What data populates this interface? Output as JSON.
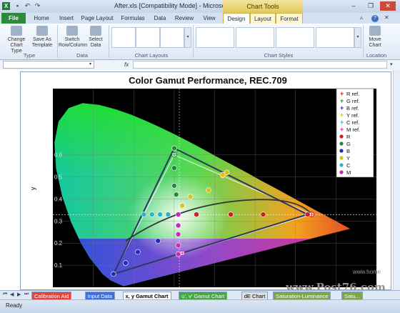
{
  "window": {
    "title": "After.xls  [Compatibility Mode] - Microsoft E...",
    "chart_tools_label": "Chart Tools",
    "quick_access": [
      "save-icon",
      "undo-icon",
      "redo-icon"
    ],
    "controls": [
      "minimize-icon",
      "restore-icon",
      "close-icon"
    ]
  },
  "tabs": [
    "File",
    "Home",
    "Insert",
    "Page Layout",
    "Formulas",
    "Data",
    "Review",
    "View",
    "Design",
    "Layout",
    "Format"
  ],
  "ribbon": {
    "groups": [
      {
        "label": "Type",
        "buttons": [
          "Change Chart Type",
          "Save As Template"
        ]
      },
      {
        "label": "Data",
        "buttons": [
          "Switch Row/Column",
          "Select Data"
        ]
      },
      {
        "label": "Chart Layouts"
      },
      {
        "label": "Chart Styles"
      },
      {
        "label": "Location",
        "buttons": [
          "Move Chart"
        ]
      }
    ]
  },
  "formula_bar": {
    "fx": "fx",
    "name_box": ""
  },
  "chart_data": {
    "type": "scatter",
    "title": "Color Gamut Performance, REC.709",
    "ylabel": "y",
    "y_ticks": [
      "0.1",
      "0.2",
      "0.3",
      "0.4",
      "0.5",
      "0.6"
    ],
    "xlim": [
      0.0,
      0.8
    ],
    "ylim": [
      0.0,
      0.9
    ],
    "legend": [
      "R ref.",
      "G ref.",
      "B ref.",
      "Y ref.",
      "C ref.",
      "M ref.",
      "R",
      "G",
      "B",
      "Y",
      "C",
      "M"
    ],
    "legend_colors": [
      "#cc2020",
      "#1f8a3a",
      "#1f2fb0",
      "#d8c21a",
      "#2ab5c0",
      "#c62bb8",
      "#cc2020",
      "#1f8a3a",
      "#1f2fb0",
      "#d8c21a",
      "#2ab5c0",
      "#c62bb8"
    ],
    "legend_placement": "top-right",
    "series": [
      {
        "name": "R ref.",
        "color": "#cc2020",
        "points": [
          [
            0.64,
            0.33
          ]
        ]
      },
      {
        "name": "G ref.",
        "color": "#1f8a3a",
        "points": [
          [
            0.3,
            0.6
          ]
        ]
      },
      {
        "name": "B ref.",
        "color": "#1f2fb0",
        "points": [
          [
            0.15,
            0.06
          ]
        ]
      },
      {
        "name": "Y ref.",
        "color": "#d8c21a",
        "points": [
          [
            0.42,
            0.505
          ]
        ]
      },
      {
        "name": "C ref.",
        "color": "#2ab5c0",
        "points": [
          [
            0.225,
            0.33
          ]
        ]
      },
      {
        "name": "M ref.",
        "color": "#c62bb8",
        "points": [
          [
            0.32,
            0.155
          ]
        ]
      },
      {
        "name": "R",
        "color": "#cc2020",
        "points": [
          [
            0.355,
            0.33
          ],
          [
            0.44,
            0.33
          ],
          [
            0.52,
            0.33
          ],
          [
            0.63,
            0.33
          ]
        ]
      },
      {
        "name": "G",
        "color": "#1f8a3a",
        "points": [
          [
            0.3,
            0.63
          ],
          [
            0.3,
            0.54
          ],
          [
            0.3,
            0.46
          ],
          [
            0.305,
            0.42
          ]
        ]
      },
      {
        "name": "B",
        "color": "#1f2fb0",
        "points": [
          [
            0.18,
            0.11
          ],
          [
            0.21,
            0.16
          ],
          [
            0.26,
            0.21
          ],
          [
            0.15,
            0.06
          ]
        ]
      },
      {
        "name": "Y",
        "color": "#d8c21a",
        "points": [
          [
            0.32,
            0.37
          ],
          [
            0.34,
            0.41
          ],
          [
            0.385,
            0.44
          ],
          [
            0.42,
            0.51
          ],
          [
            0.43,
            0.52
          ]
        ]
      },
      {
        "name": "C",
        "color": "#2ab5c0",
        "points": [
          [
            0.245,
            0.33
          ],
          [
            0.265,
            0.33
          ],
          [
            0.285,
            0.33
          ],
          [
            0.225,
            0.33
          ]
        ]
      },
      {
        "name": "M",
        "color": "#c62bb8",
        "points": [
          [
            0.31,
            0.33
          ],
          [
            0.31,
            0.28
          ],
          [
            0.31,
            0.24
          ],
          [
            0.31,
            0.19
          ],
          [
            0.31,
            0.15
          ]
        ]
      }
    ]
  },
  "sheets": [
    "Calibration Aid",
    "Input Data",
    "x, y Gamut Chart",
    "u', v' Gamut Chart",
    "dE Chart",
    "Saturation-Luminance",
    "Satu..."
  ],
  "sheet_colors": [
    "#e8423c",
    "#3e6fe0",
    "#ffffff",
    "#44a844",
    "#e0e0e0",
    "#7aa74a",
    "#7aa74a"
  ],
  "active_sheet": "x, y Gamut Chart",
  "status": {
    "text": "Ready"
  },
  "watermark": {
    "text": "www.Post76.com",
    "subtext": "www.home"
  }
}
